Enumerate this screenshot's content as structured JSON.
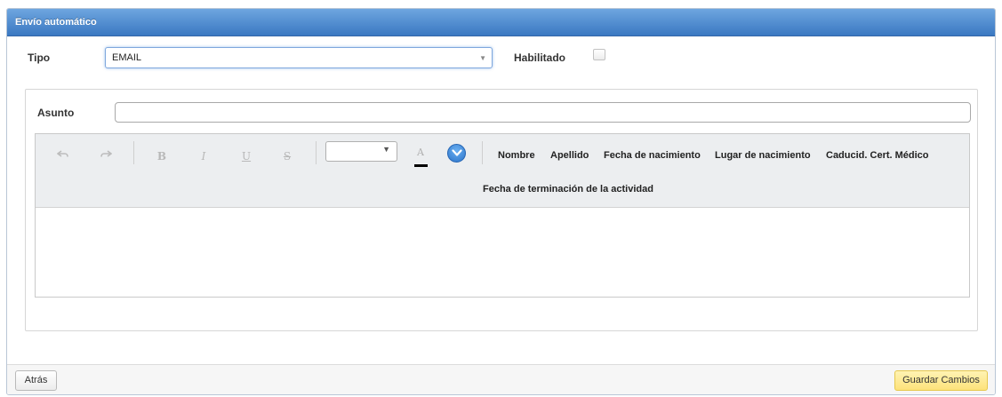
{
  "panel": {
    "title": "Envío automático"
  },
  "form": {
    "tipo_label": "Tipo",
    "tipo_value": "EMAIL",
    "habilitado_label": "Habilitado",
    "habilitado_checked": false,
    "asunto_label": "Asunto",
    "asunto_value": ""
  },
  "editor": {
    "toolbar": {
      "undo_icon": "undo-icon",
      "redo_icon": "redo-icon",
      "bold": "B",
      "italic": "I",
      "underline": "U",
      "strike": "S",
      "font_size_value": "",
      "font_color_glyph": "A",
      "font_color": "#000000",
      "more_icon": "chevron-down-circle-icon"
    },
    "fields": [
      "Nombre",
      "Apellido",
      "Fecha de nacimiento",
      "Lugar de nacimiento",
      "Caducid. Cert. Médico",
      "Fecha de terminación de la actividad"
    ],
    "content": ""
  },
  "footer": {
    "back_label": "Atrás",
    "save_label": "Guardar Cambios"
  },
  "colors": {
    "header": "#3a78c2",
    "save_button": "#fde27a"
  }
}
